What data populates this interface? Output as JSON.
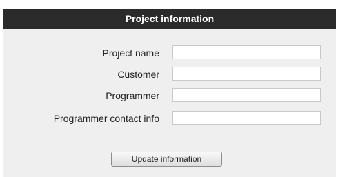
{
  "header": {
    "title": "Project information"
  },
  "form": {
    "fields": [
      {
        "label": "Project name",
        "value": "",
        "placeholder": ""
      },
      {
        "label": "Customer",
        "value": "",
        "placeholder": ""
      },
      {
        "label": "Programmer",
        "value": "",
        "placeholder": ""
      },
      {
        "label": "Programmer contact info",
        "value": "",
        "placeholder": ""
      }
    ],
    "submit_label": "Update information"
  },
  "colors": {
    "header_bg": "#2b2b2b",
    "header_text": "#ffffff",
    "panel_bg": "#efefef"
  }
}
